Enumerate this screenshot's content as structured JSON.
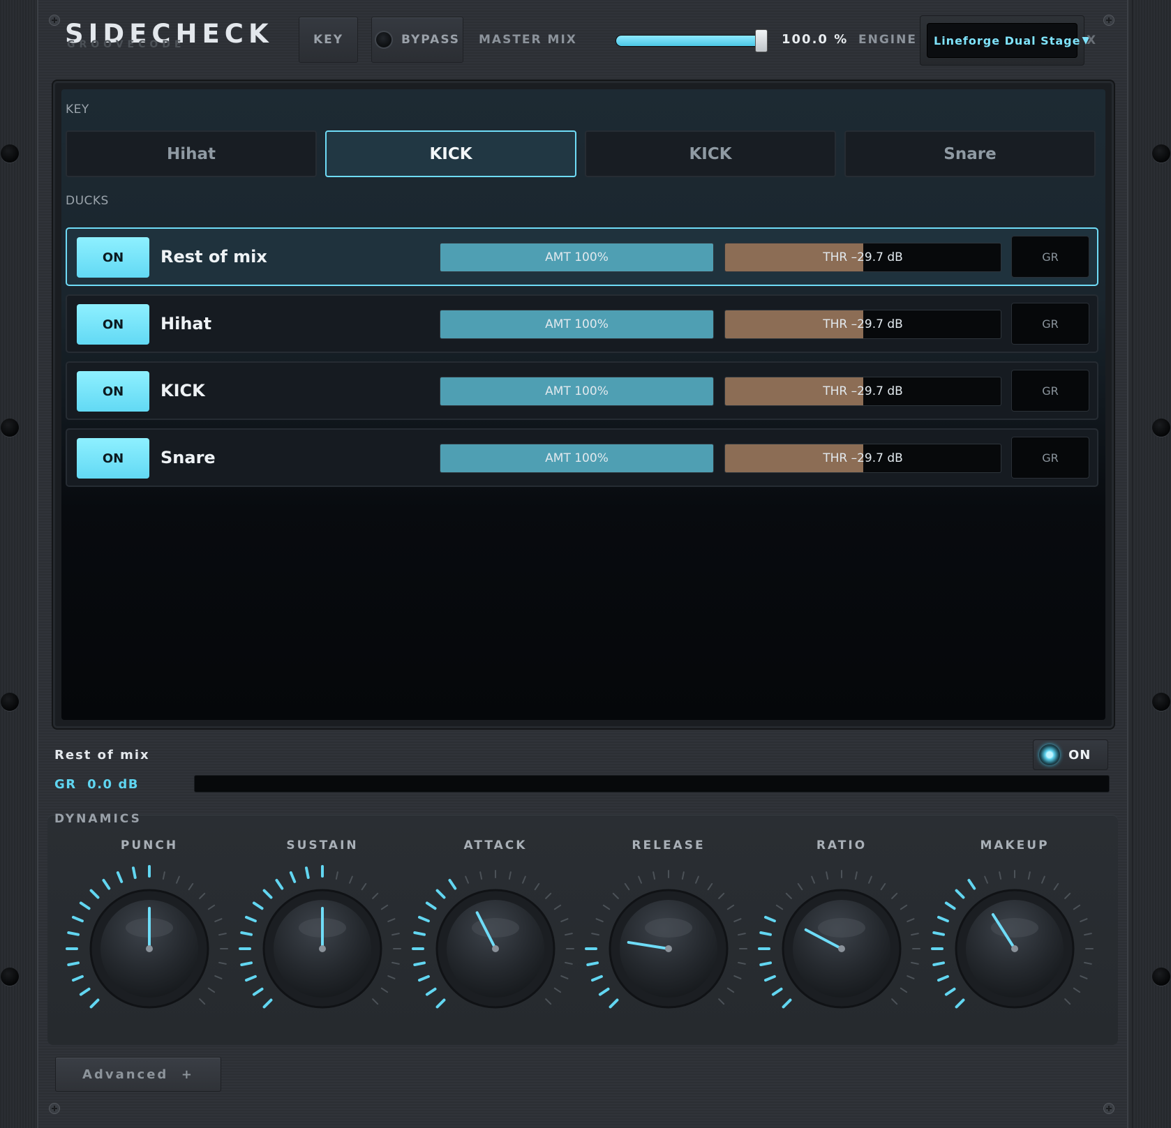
{
  "header": {
    "brand": "SIDECHECK",
    "brand_sub": "GROOVECODE",
    "key_button": "KEY",
    "bypass_button": "BYPASS",
    "master_mix_label": "MASTER MIX",
    "master_mix_value": "100.0 %",
    "master_mix_fraction": 1.0,
    "engine_label": "ENGINE",
    "engine_value": "Lineforge Dual Stage",
    "close_label": "X"
  },
  "key_section": {
    "label": "KEY",
    "tabs": [
      {
        "label": "Hihat",
        "active": false
      },
      {
        "label": "KICK",
        "active": true
      },
      {
        "label": "KICK",
        "active": false
      },
      {
        "label": "Snare",
        "active": false
      }
    ]
  },
  "ducks_section": {
    "label": "DUCKS",
    "rows": [
      {
        "on_label": "ON",
        "name": "Rest of mix",
        "amt_label": "AMT 100%",
        "amt_fraction": 1.0,
        "thr_label": "THR –29.7 dB",
        "thr_fraction": 0.5,
        "gr_label": "GR",
        "selected": true
      },
      {
        "on_label": "ON",
        "name": "Hihat",
        "amt_label": "AMT 100%",
        "amt_fraction": 1.0,
        "thr_label": "THR –29.7 dB",
        "thr_fraction": 0.5,
        "gr_label": "GR",
        "selected": false
      },
      {
        "on_label": "ON",
        "name": "KICK",
        "amt_label": "AMT 100%",
        "amt_fraction": 1.0,
        "thr_label": "THR –29.7 dB",
        "thr_fraction": 0.5,
        "gr_label": "GR",
        "selected": false
      },
      {
        "on_label": "ON",
        "name": "Snare",
        "amt_label": "AMT 100%",
        "amt_fraction": 1.0,
        "thr_label": "THR –29.7 dB",
        "thr_fraction": 0.5,
        "gr_label": "GR",
        "selected": false
      }
    ]
  },
  "selected_strip": {
    "name": "Rest of mix",
    "gr_text": "GR  0.0 dB",
    "on_label": "ON"
  },
  "dynamics": {
    "label": "DYNAMICS",
    "knobs": [
      {
        "label": "PUNCH",
        "fraction": 0.5
      },
      {
        "label": "SUSTAIN",
        "fraction": 0.5
      },
      {
        "label": "ATTACK",
        "fraction": 0.4
      },
      {
        "label": "RELEASE",
        "fraction": 0.2
      },
      {
        "label": "RATIO",
        "fraction": 0.27
      },
      {
        "label": "MAKEUP",
        "fraction": 0.38
      }
    ]
  },
  "advanced_button": "Advanced  +",
  "colors": {
    "accent": "#6fdcf7",
    "amount": "#4f9fb3",
    "threshold": "#8c6d55",
    "background": "#2c2f34"
  }
}
